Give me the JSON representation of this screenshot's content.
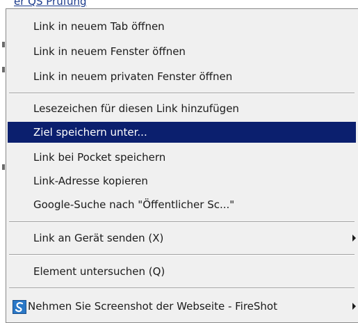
{
  "page": {
    "link_text": "er QS Prüfung"
  },
  "menu": {
    "items": [
      {
        "label": "Link in neuem Tab öffnen"
      },
      {
        "label": "Link in neuem Fenster öffnen"
      },
      {
        "label": "Link in neuem privaten Fenster öffnen"
      },
      {
        "label": "Lesezeichen für diesen Link hinzufügen"
      },
      {
        "label": "Ziel speichern unter..."
      },
      {
        "label": "Link bei Pocket speichern"
      },
      {
        "label": "Link-Adresse kopieren"
      },
      {
        "label": "Google-Suche nach \"Öffentlicher Sc...\""
      },
      {
        "label": "Link an Gerät senden (X)"
      },
      {
        "label": "Element untersuchen (Q)"
      },
      {
        "label": "Nehmen Sie Screenshot der Webseite - FireShot"
      }
    ],
    "highlighted_index": 4,
    "colors": {
      "background": "#f0f0f0",
      "highlight": "#0b1f6e",
      "highlight_text": "#ffffff",
      "text": "#1b1b1b"
    },
    "icons": {
      "fireshot": "fireshot-icon",
      "submenu": "submenu-arrow-icon"
    }
  }
}
